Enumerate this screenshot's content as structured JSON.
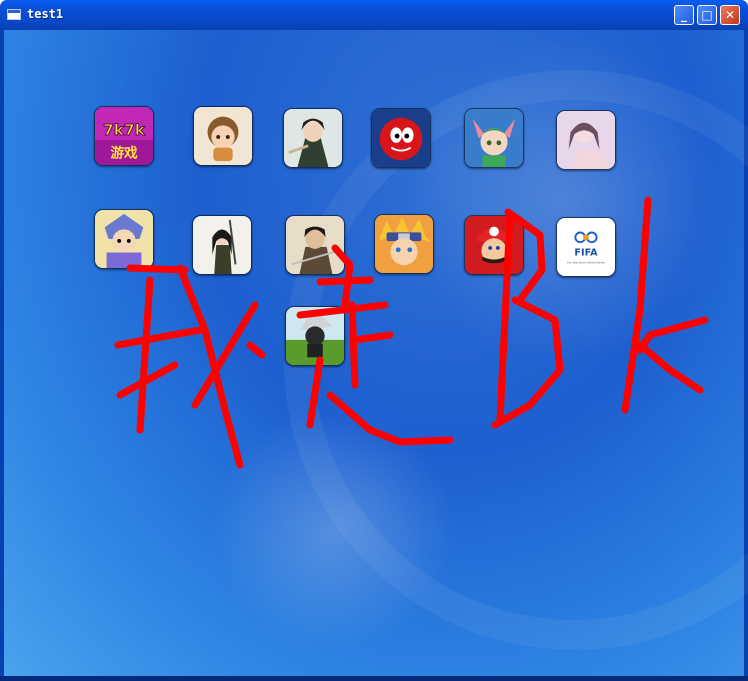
{
  "window": {
    "title": "test1",
    "minimize_label": "_",
    "maximize_label": "□",
    "close_label": "✕"
  },
  "icons": [
    {
      "name": "7k7k-game-icon",
      "text_top": "7k7k",
      "text_bottom": "游戏"
    },
    {
      "name": "cartoon-boy-game-icon"
    },
    {
      "name": "warrior-girl-game-icon"
    },
    {
      "name": "red-ball-game-icon"
    },
    {
      "name": "fox-girl-game-icon"
    },
    {
      "name": "portrait-girl-game-icon"
    },
    {
      "name": "armored-hero-game-icon"
    },
    {
      "name": "archer-girl-game-icon"
    },
    {
      "name": "swordsman-game-icon"
    },
    {
      "name": "naruto-game-icon"
    },
    {
      "name": "mario-game-icon"
    },
    {
      "name": "fifa-game-icon",
      "text": "FIFA",
      "caption": "For the Good of the Game"
    },
    {
      "name": "ninja-game-icon"
    }
  ],
  "annotation": {
    "text": "我是Bk",
    "color": "#ff0000"
  }
}
